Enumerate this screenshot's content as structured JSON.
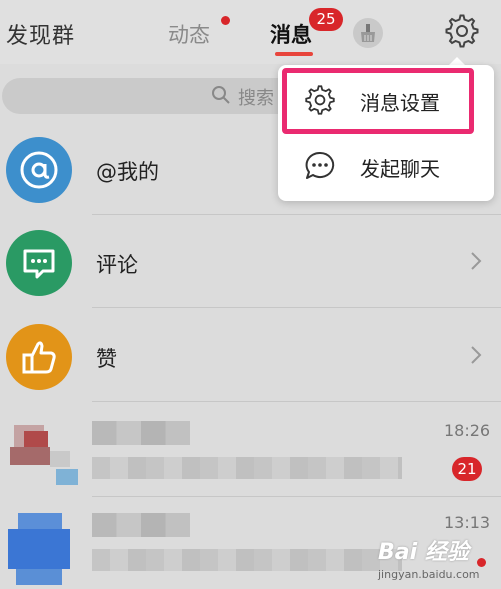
{
  "header": {
    "brand": "发现群",
    "tab_dynamics": "动态",
    "tab_messages": "消息",
    "messages_badge": "25"
  },
  "search": {
    "placeholder": "搜索"
  },
  "list": {
    "items": [
      {
        "label": "@我的",
        "icon": "at-icon",
        "color": "#3d8fcc"
      },
      {
        "label": "评论",
        "icon": "comment-icon",
        "color": "#2a9a64"
      },
      {
        "label": "赞",
        "icon": "thumbs-up-icon",
        "color": "#e29418"
      }
    ]
  },
  "conversations": [
    {
      "time": "18:26",
      "badge": "21"
    },
    {
      "time": "13:13"
    }
  ],
  "menu": {
    "settings_label": "消息设置",
    "chat_label": "发起聊天"
  },
  "watermark": {
    "brand": "Bai 经验",
    "url": "jingyan.baidu.com"
  },
  "colors": {
    "accent_red": "#d8262a",
    "highlight_pink": "#ea2a70"
  }
}
